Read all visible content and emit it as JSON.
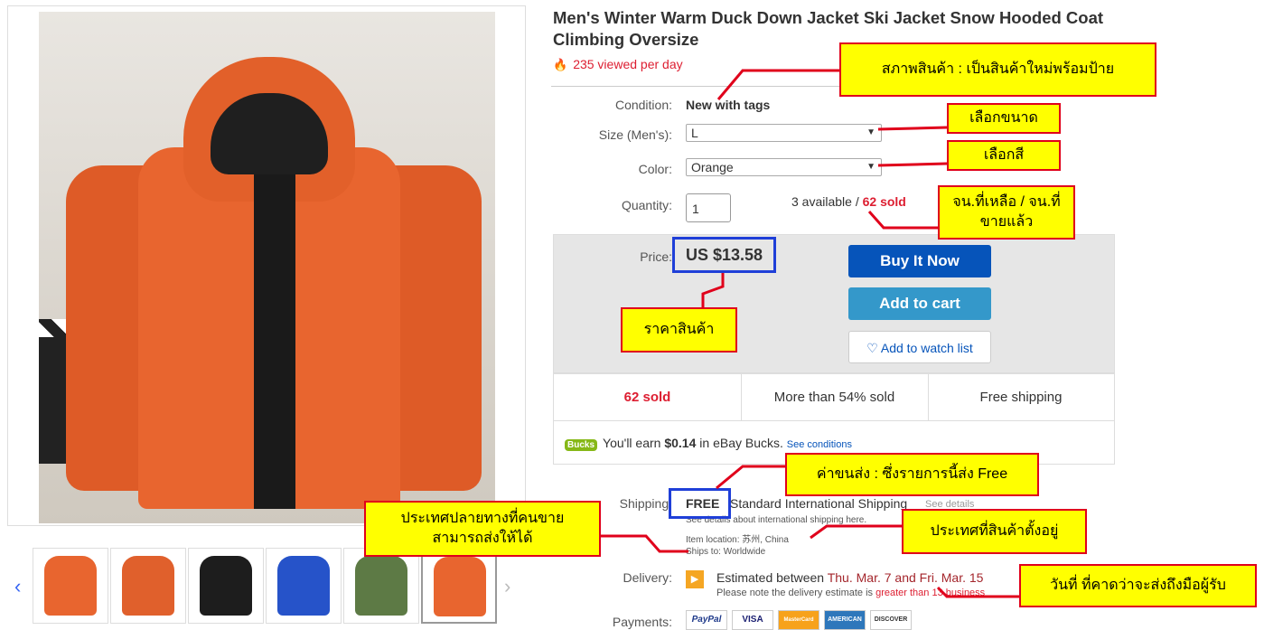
{
  "product": {
    "title": "Men's Winter Warm Duck Down Jacket Ski Jacket Snow Hooded Coat Climbing Oversize",
    "viewed": "235 viewed per day"
  },
  "details": {
    "condition_label": "Condition:",
    "condition_value": "New with tags",
    "size_label": "Size (Men's):",
    "size_value": "L",
    "color_label": "Color:",
    "color_value": "Orange",
    "quantity_label": "Quantity:",
    "quantity_value": "1",
    "available_text": "3 available / ",
    "sold_text": "62 sold"
  },
  "buybox": {
    "price_label": "Price:",
    "price_value": "US $13.58",
    "buy_now": "Buy It Now",
    "add_to_cart": "Add to cart",
    "watch": "♡ Add to watch list"
  },
  "stats": [
    "62 sold",
    "More than 54% sold",
    "Free shipping"
  ],
  "bucks": {
    "logo": "Bucks",
    "earn_pre": "You'll earn ",
    "earn_amount": "$0.14",
    "earn_post": " in eBay Bucks. ",
    "conditions": "See conditions"
  },
  "shipping": {
    "label": "Shipping:",
    "free": "FREE",
    "method": "Standard International Shipping",
    "see_details": "See details",
    "intl_note": "See details about international shipping here.",
    "item_location": "Item location:  苏州, China",
    "ships_to": "Ships to:  Worldwide"
  },
  "delivery": {
    "label": "Delivery:",
    "estimated": "Estimated between ",
    "dates": "Thu. Mar. 7 and Fri. Mar. 15",
    "note": "Please note the delivery estimate is ",
    "note_red": "greater than 13 business"
  },
  "payments": {
    "label": "Payments:",
    "methods": [
      "PayPal",
      "VISA",
      "MasterCard",
      "AMERICAN",
      "DISCOVER"
    ]
  },
  "annotations": {
    "condition": "สภาพสินค้า : เป็นสินค้าใหม่พร้อมป้าย",
    "size": "เลือกขนาด",
    "color": "เลือกสี",
    "quantity": "จน.ที่เหลือ / จน.ที่ขายแล้ว",
    "price": "ราคาสินค้า",
    "shipping_cost": "ค่าขนส่ง : ซึ่งรายการนี้ส่ง Free",
    "destination": "ประเทศปลายทางที่คนขายสามารถส่งให้ได้",
    "location": "ประเทศที่สินค้าตั้งอยู่",
    "delivery_date": "วันที่ ที่คาดว่าจะส่งถึงมือผู้รับ"
  },
  "colors": {
    "accent_red": "#e0001b",
    "note_yellow": "#ffff00",
    "highlight_blue": "#1f3fd8",
    "ebay_blue": "#0654ba",
    "jacket_orange": "#e8652f"
  },
  "thumbnails": [
    "orange-front",
    "orange-side",
    "black",
    "blue",
    "green",
    "orange-selected"
  ]
}
